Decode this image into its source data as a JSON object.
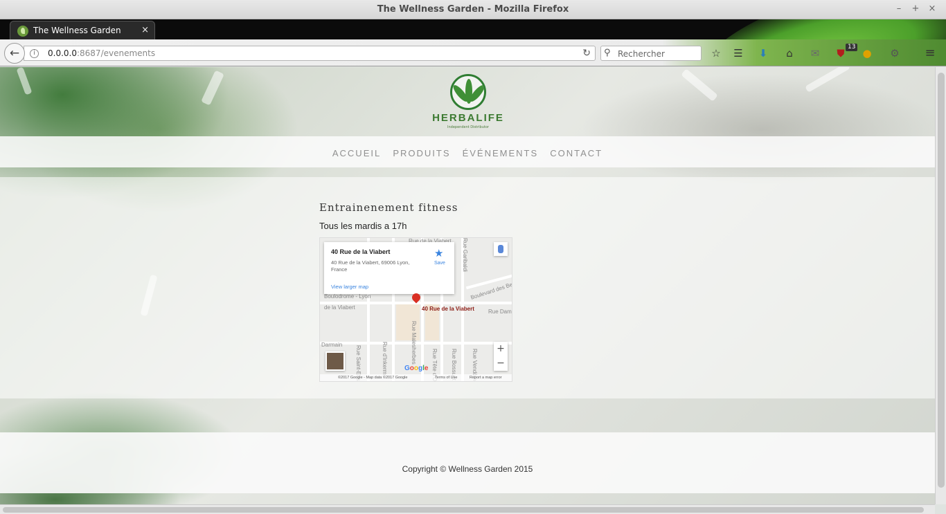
{
  "window": {
    "title": "The Wellness Garden - Mozilla Firefox",
    "minimize": "–",
    "maximize": "+",
    "close": "×"
  },
  "tab": {
    "title": "The Wellness Garden",
    "close": "×",
    "new_tab": "+"
  },
  "navbar": {
    "url_host": "0.0.0.0",
    "url_path": ":8687/evenements",
    "search_placeholder": "Rechercher",
    "extension_badge": "13"
  },
  "site": {
    "logo_text": "HERBALIFE",
    "logo_subtitle": "Independent Distributor",
    "menu": [
      "ACCUEIL",
      "PRODUITS",
      "ÉVÉNEMENTS",
      "CONTACT"
    ]
  },
  "event": {
    "title": "Entrainenement fitness",
    "description": "Tous les mardis a 17h"
  },
  "map": {
    "place_name": "40 Rue de la Viabert",
    "address": "40 Rue de la Viabert, 69006 Lyon, France",
    "view_larger": "View larger map",
    "save_label": "Save",
    "pin_label": "40 Rue de la Viabert",
    "zoom_in": "+",
    "zoom_out": "−",
    "google": "Google",
    "footer_data": "©2017 Google - Map data ©2017 Google",
    "footer_terms": "Terms of Use",
    "footer_report": "Report a map error",
    "street_labels": [
      "Rue de la Viabert",
      "Boulodrome - Lyon",
      "de la Viabert",
      "Darmain",
      "Rue Saint-Eusèbe",
      "Rue d'Inkerm",
      "Rue Tête d'Or",
      "Rue Bossuet",
      "Rue Vendôme",
      "Boulevard des Belges",
      "Rue Malesherbes",
      "Rue Garibaldi",
      "Rue Dam"
    ]
  },
  "footer": {
    "copyright": "Copyright © Wellness Garden 2015"
  }
}
